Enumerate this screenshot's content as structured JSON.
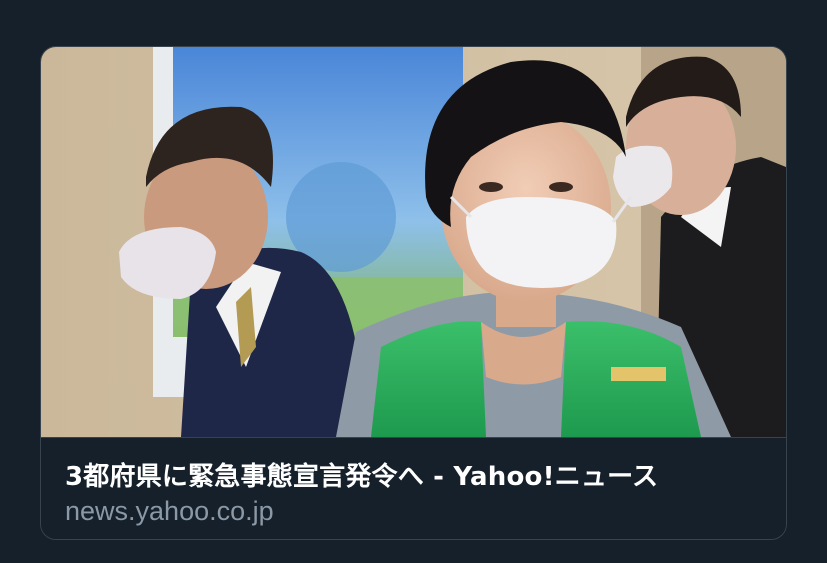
{
  "link_card": {
    "image": {
      "description_icon": "news-photo"
    },
    "title": "3都府県に緊急事態宣言発令へ - Yahoo!ニュース",
    "domain": "news.yahoo.co.jp"
  },
  "colors": {
    "background": "#15202b",
    "border": "#38444d",
    "title_text": "#ffffff",
    "domain_text": "#8b98a5"
  }
}
